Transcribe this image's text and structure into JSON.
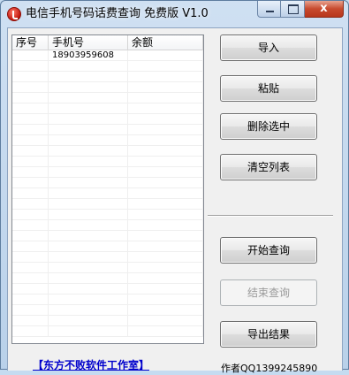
{
  "window": {
    "title": "电信手机号码话费查询 免费版 V1.0",
    "close_glyph": "x"
  },
  "list": {
    "columns": [
      "序号",
      "手机号",
      "余额"
    ],
    "rows": [
      {
        "index": "",
        "phone": "18903959608",
        "balance": ""
      }
    ]
  },
  "buttons": {
    "import": "导入",
    "paste": "粘贴",
    "delete_selected": "删除选中",
    "clear_list": "清空列表",
    "start_query": "开始查询",
    "end_query": "结束查询",
    "export_results": "导出结果"
  },
  "footer": {
    "vendor_link": "【东方不败软件工作室】",
    "author": "作者QQ1399245890"
  }
}
